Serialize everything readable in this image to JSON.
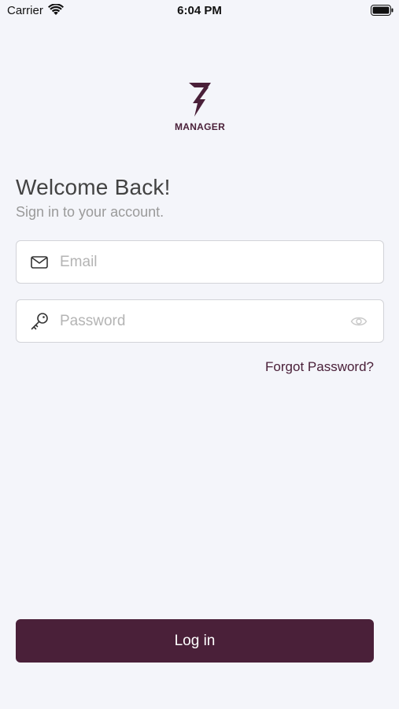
{
  "status_bar": {
    "carrier": "Carrier",
    "time": "6:04 PM",
    "icons": [
      "wifi-icon",
      "battery-icon"
    ]
  },
  "logo": {
    "text": "MANAGER",
    "icon": "lightning-icon"
  },
  "login": {
    "title": "Welcome Back!",
    "subtitle": "Sign in to your account.",
    "email": {
      "value": "",
      "placeholder": "Email",
      "icon": "mail-icon"
    },
    "password": {
      "value": "",
      "placeholder": "Password",
      "icon": "key-icon",
      "toggle_icon": "eye-icon"
    },
    "forgot_label": "Forgot Password?",
    "button_label": "Log in"
  },
  "colors": {
    "brand": "#4a2039",
    "background": "#f4f5fa",
    "field_border": "#d2d3d8",
    "placeholder": "#b4b4b4",
    "title": "#434343",
    "subtitle": "#9a9a9a"
  }
}
